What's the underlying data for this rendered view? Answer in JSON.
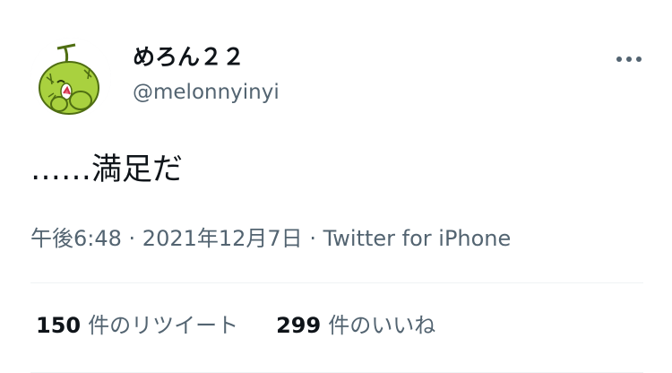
{
  "user": {
    "display_name": "めろん２２",
    "handle": "@melonnyinyi",
    "avatar_icon": "melon-character-avatar"
  },
  "more_icon": "more-horizontal-icon",
  "tweet": {
    "text": "……満足だ"
  },
  "meta": {
    "time": "午後6:48",
    "separator1": " · ",
    "date": "2021年12月7日",
    "separator2": " · ",
    "source": "Twitter for iPhone"
  },
  "stats": {
    "retweets": {
      "count": "150",
      "label": "件のリツイート"
    },
    "likes": {
      "count": "299",
      "label": "件のいいね"
    }
  },
  "colors": {
    "text_primary": "#0f1419",
    "text_secondary": "#536471",
    "divider": "#eff3f4",
    "avatar_green": "#a9d13f"
  }
}
